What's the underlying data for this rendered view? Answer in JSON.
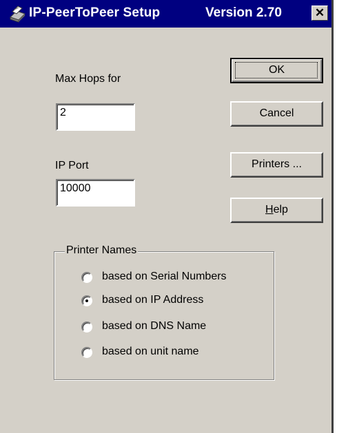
{
  "window": {
    "title": "IP-PeerToPeer Setup",
    "version": "Version 2.70",
    "close_glyph": "✕"
  },
  "fields": {
    "max_hops_label": "Max Hops for",
    "max_hops_value": "2",
    "ip_port_label": "IP Port",
    "ip_port_value": "10000"
  },
  "buttons": {
    "ok": "OK",
    "cancel": "Cancel",
    "printers": "Printers ...",
    "help_mnemonic": "H",
    "help_rest": "elp"
  },
  "printer_names": {
    "legend": "Printer Names",
    "options": [
      {
        "label": "based on Serial Numbers",
        "selected": false
      },
      {
        "label": "based on IP Address",
        "selected": true
      },
      {
        "label": "based on DNS Name",
        "selected": false
      },
      {
        "label": "based on unit name",
        "selected": false
      }
    ]
  },
  "colors": {
    "titlebar": "#000080",
    "face": "#d4d0c8"
  }
}
